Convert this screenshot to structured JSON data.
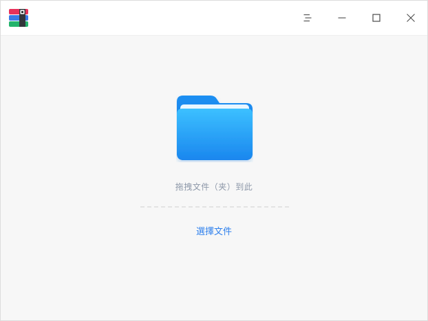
{
  "titlebar": {
    "logo_icon": "archive-app-icon",
    "buttons": {
      "menu_icon": "menu-icon",
      "minimize_icon": "minimize-icon",
      "maximize_icon": "maximize-icon",
      "close_icon": "close-icon"
    }
  },
  "main": {
    "folder_icon": "folder-icon",
    "drop_hint": "拖拽文件（夹）到此",
    "select_files_label": "選擇文件"
  },
  "colors": {
    "background": "#f7f7f7",
    "titlebar": "#ffffff",
    "hint_text": "#8c97a8",
    "link": "#2f80ed",
    "folder": "#1a8df0"
  }
}
